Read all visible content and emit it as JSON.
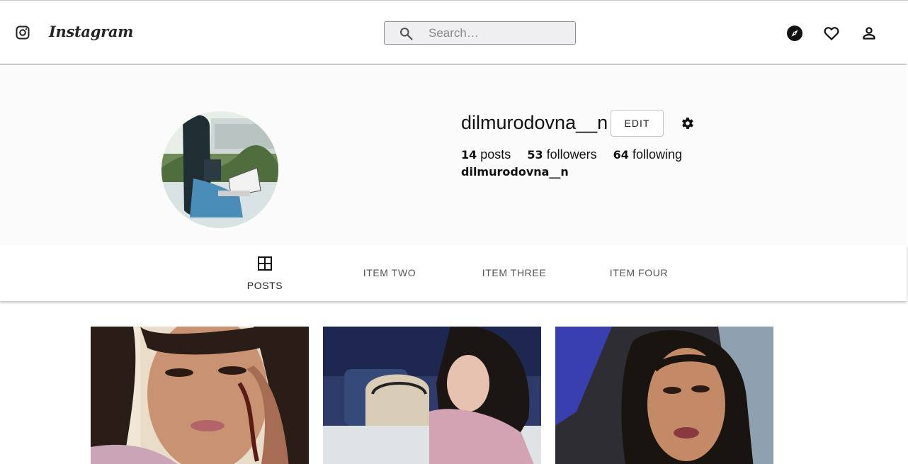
{
  "header": {
    "logo_text": "Instagram",
    "search_placeholder": "Search…",
    "icons": [
      "instagram-icon",
      "search-icon",
      "explore-icon",
      "heart-icon",
      "person-icon"
    ]
  },
  "profile": {
    "username": "dilmurodovna__n",
    "edit_label": "EDIT",
    "posts_count": "14",
    "posts_label": "posts",
    "followers_count": "53",
    "followers_label": "followers",
    "following_count": "64",
    "following_label": "following",
    "full_name": "dilmurodovna__n"
  },
  "tabs": [
    {
      "label": "POSTS",
      "icon": "grid-icon",
      "active": true
    },
    {
      "label": "ITEM TWO",
      "active": false
    },
    {
      "label": "ITEM THREE",
      "active": false
    },
    {
      "label": "ITEM FOUR",
      "active": false
    }
  ],
  "posts": [
    {
      "image": "selfie-portrait-henna-hand"
    },
    {
      "image": "woman-writing-at-table"
    },
    {
      "image": "selfie-in-car"
    }
  ],
  "colors": {
    "header_bg": "#ffffff",
    "profile_bg": "#fafbfa",
    "text": "#111111",
    "search_bg": "#efeff1"
  }
}
